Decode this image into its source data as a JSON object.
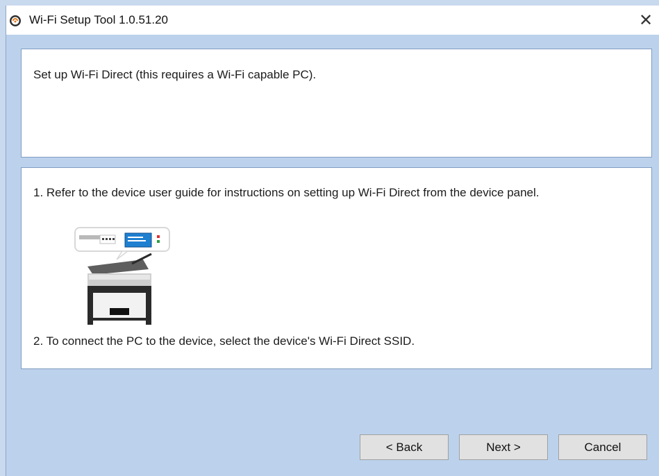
{
  "window": {
    "title": "Wi-Fi Setup Tool 1.0.51.20",
    "close_glyph": "✕"
  },
  "header": {
    "text": "Set up Wi-Fi Direct (this requires a Wi-Fi capable PC)."
  },
  "instructions": {
    "step1": "1. Refer to the device user guide for instructions on setting up Wi-Fi Direct from the device panel.",
    "step2": "2. To connect the PC to the device, select the device's Wi-Fi Direct SSID.",
    "illustration_icon": "printer-control-panel-illustration"
  },
  "buttons": {
    "back": "< Back",
    "next": "Next >",
    "cancel": "Cancel"
  },
  "colors": {
    "window_background": "#bcd2ec",
    "panel_border": "#7f9cc2",
    "screen_blue": "#1e7fd0"
  }
}
